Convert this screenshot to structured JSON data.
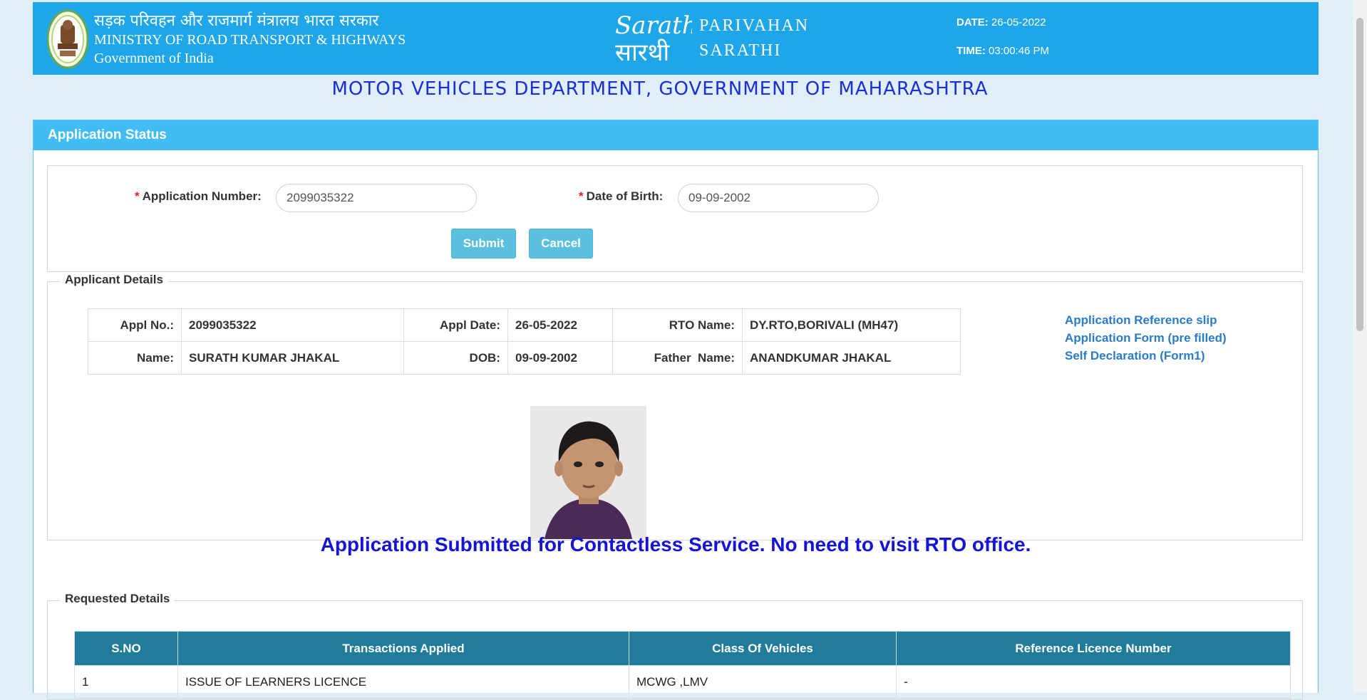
{
  "header": {
    "ministry_hindi": "सड़क परिवहन और राजमार्ग मंत्रालय भारत सरकार",
    "ministry_english": "MINISTRY OF ROAD TRANSPORT & HIGHWAYS",
    "government": "Government of India",
    "brand_line1": "PARIVAHAN",
    "brand_line2": "SARATHI",
    "logo_text_en": "Sarathi",
    "logo_text_hi": "सारथी",
    "date_label": "DATE:",
    "date_value": "26-05-2022",
    "time_label": "TIME:",
    "time_value": "03:00:46 PM"
  },
  "department_title": "MOTOR VEHICLES DEPARTMENT, GOVERNMENT OF MAHARASHTRA",
  "panel": {
    "title": "Application Status"
  },
  "form": {
    "required_mark": "*",
    "application_number_label": "Application Number:",
    "application_number_value": "2099035322",
    "dob_label": "Date of Birth:",
    "dob_value": "09-09-2002",
    "submit_label": "Submit",
    "cancel_label": "Cancel"
  },
  "applicant_details": {
    "legend": "Applicant Details",
    "rows": [
      [
        {
          "label": "Appl No.:",
          "value": "2099035322"
        },
        {
          "label": "Appl Date:",
          "value": "26-05-2022"
        },
        {
          "label": "RTO Name:",
          "value": "DY.RTO,BORIVALI (MH47)"
        }
      ],
      [
        {
          "label": "Name:",
          "value": "SURATH KUMAR JHAKAL"
        },
        {
          "label": "DOB:",
          "value": "09-09-2002"
        },
        {
          "label": "Father  Name:",
          "value": "ANANDKUMAR JHAKAL"
        }
      ]
    ],
    "links": [
      "Application Reference slip",
      "Application Form (pre filled)",
      "Self Declaration (Form1)"
    ]
  },
  "notice": "Application Submitted for Contactless Service. No need to visit RTO office.",
  "requested_details": {
    "legend": "Requested Details",
    "columns": [
      "S.NO",
      "Transactions Applied",
      "Class Of Vehicles",
      "Reference Licence Number"
    ],
    "rows": [
      [
        "1",
        "ISSUE OF LEARNERS LICENCE",
        "MCWG ,LMV",
        "-"
      ]
    ]
  },
  "colors": {
    "header_bg": "#1ea6e8",
    "panel_head_bg": "#42bdf3",
    "table_head_bg": "#207c9a",
    "notice_text": "#1414d4",
    "link": "#2a7cc7",
    "button": "#5bc0de"
  }
}
